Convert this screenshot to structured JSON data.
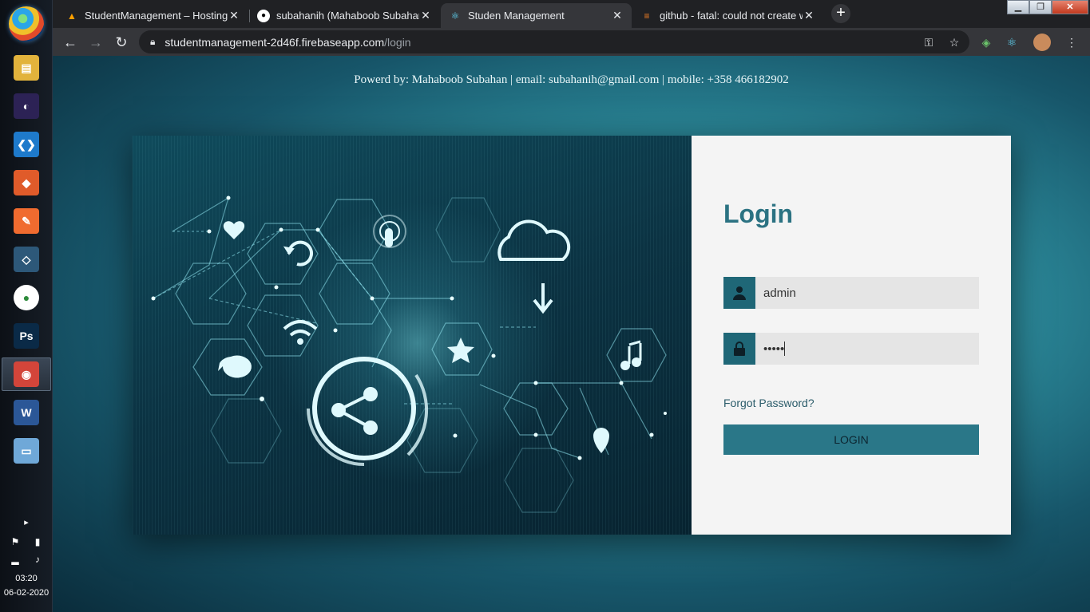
{
  "taskbar": {
    "apps": [
      {
        "name": "file-explorer",
        "glyph": "▤",
        "color": "#e2b33c"
      },
      {
        "name": "eclipse",
        "glyph": "◐",
        "color": "#2c2255"
      },
      {
        "name": "vscode",
        "glyph": "❮❯",
        "color": "#1e7acb"
      },
      {
        "name": "git-gui",
        "glyph": "◆",
        "color": "#e05b2a"
      },
      {
        "name": "postman",
        "glyph": "✎",
        "color": "#f06b2f"
      },
      {
        "name": "mysql-workbench",
        "glyph": "◇",
        "color": "#2d5879"
      },
      {
        "name": "mongodb-compass",
        "glyph": "●",
        "color": "#ffffff"
      },
      {
        "name": "photoshop",
        "glyph": "Ps",
        "color": "#0a2a47"
      },
      {
        "name": "chrome",
        "glyph": "◉",
        "color": "#d3453a"
      },
      {
        "name": "word",
        "glyph": "W",
        "color": "#2b5797"
      },
      {
        "name": "notepad",
        "glyph": "▭",
        "color": "#6fa8d8"
      }
    ],
    "clock_time": "03:20",
    "clock_date": "06-02-2020",
    "tray_arrow": "▸"
  },
  "browser": {
    "tabs": [
      {
        "title": "StudentManagement – Hosting –",
        "favicon": "firebase-icon",
        "active": false
      },
      {
        "title": "subahanih (Mahaboob Subahan)",
        "favicon": "github-icon",
        "active": false
      },
      {
        "title": "Studen Management",
        "favicon": "react-icon",
        "active": true
      },
      {
        "title": "github - fatal: could not create w",
        "favicon": "stackoverflow-icon",
        "active": false
      }
    ],
    "url_host": "studentmanagement-2d46f.firebaseapp.com",
    "url_path": "/login"
  },
  "page": {
    "powered_by": "Powerd by: Mahaboob Subahan | email: subahanih@gmail.com | mobile: +358 466182902",
    "login": {
      "title": "Login",
      "username_value": "admin",
      "password_value": "•••••",
      "forgot_label": "Forgot Password?",
      "button_label": "LOGIN"
    }
  },
  "colors": {
    "accent": "#2a7788",
    "title": "#2b7282"
  }
}
